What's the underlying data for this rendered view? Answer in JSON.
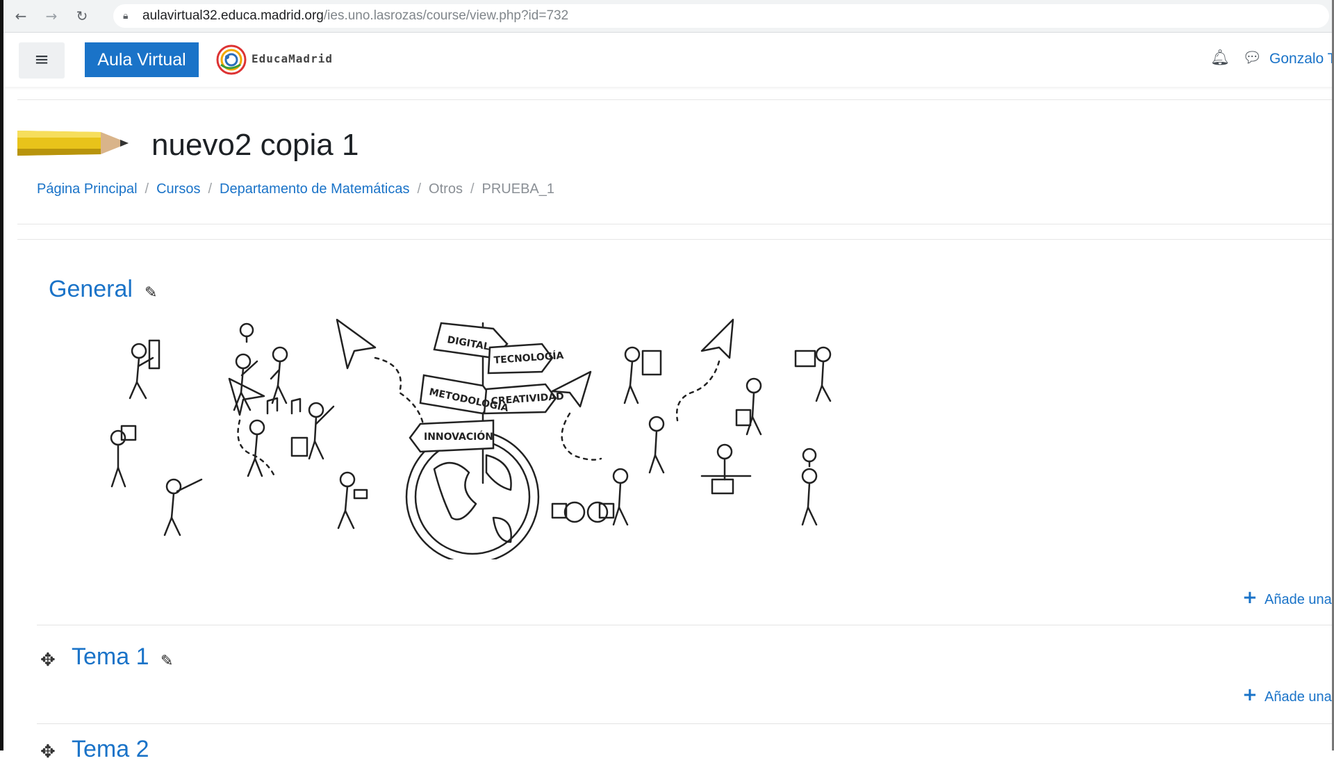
{
  "browser": {
    "back_icon": "arrow-left-icon",
    "forward_icon": "arrow-right-icon",
    "reload_icon": "reload-icon",
    "lock_icon": "lock-icon",
    "url_host": "aulavirtual32.educa.madrid.org",
    "url_path": "/ies.uno.lasrozas/course/view.php?id=732"
  },
  "navbar": {
    "menu_icon": "hamburger-icon",
    "brand_label": "Aula Virtual",
    "logo_text": "EducaMadrid",
    "notification_icon": "bell-icon",
    "messages_icon": "chat-bubble-icon",
    "user_name": "Gonzalo T"
  },
  "header": {
    "course_title": "nuevo2 copia 1",
    "breadcrumb": [
      {
        "label": "Página Principal",
        "link": true
      },
      {
        "label": "Cursos",
        "link": true
      },
      {
        "label": "Departamento de Matemáticas",
        "link": true
      },
      {
        "label": "Otros",
        "link": false
      },
      {
        "label": "PRUEBA_1",
        "link": false
      }
    ]
  },
  "sections": [
    {
      "title": "General",
      "add_label": "Añade una"
    },
    {
      "title": "Tema 1",
      "add_label": "Añade una"
    },
    {
      "title": "Tema 2"
    }
  ],
  "illustration": {
    "signs": [
      "DIGITAL",
      "TECNOLOGÍA",
      "METODOLOGÍA",
      "CREATIVIDAD",
      "INNOVACIÓN"
    ]
  },
  "colors": {
    "accent": "#1a73c8",
    "text": "#1d2125",
    "muted": "#8a8f95"
  }
}
